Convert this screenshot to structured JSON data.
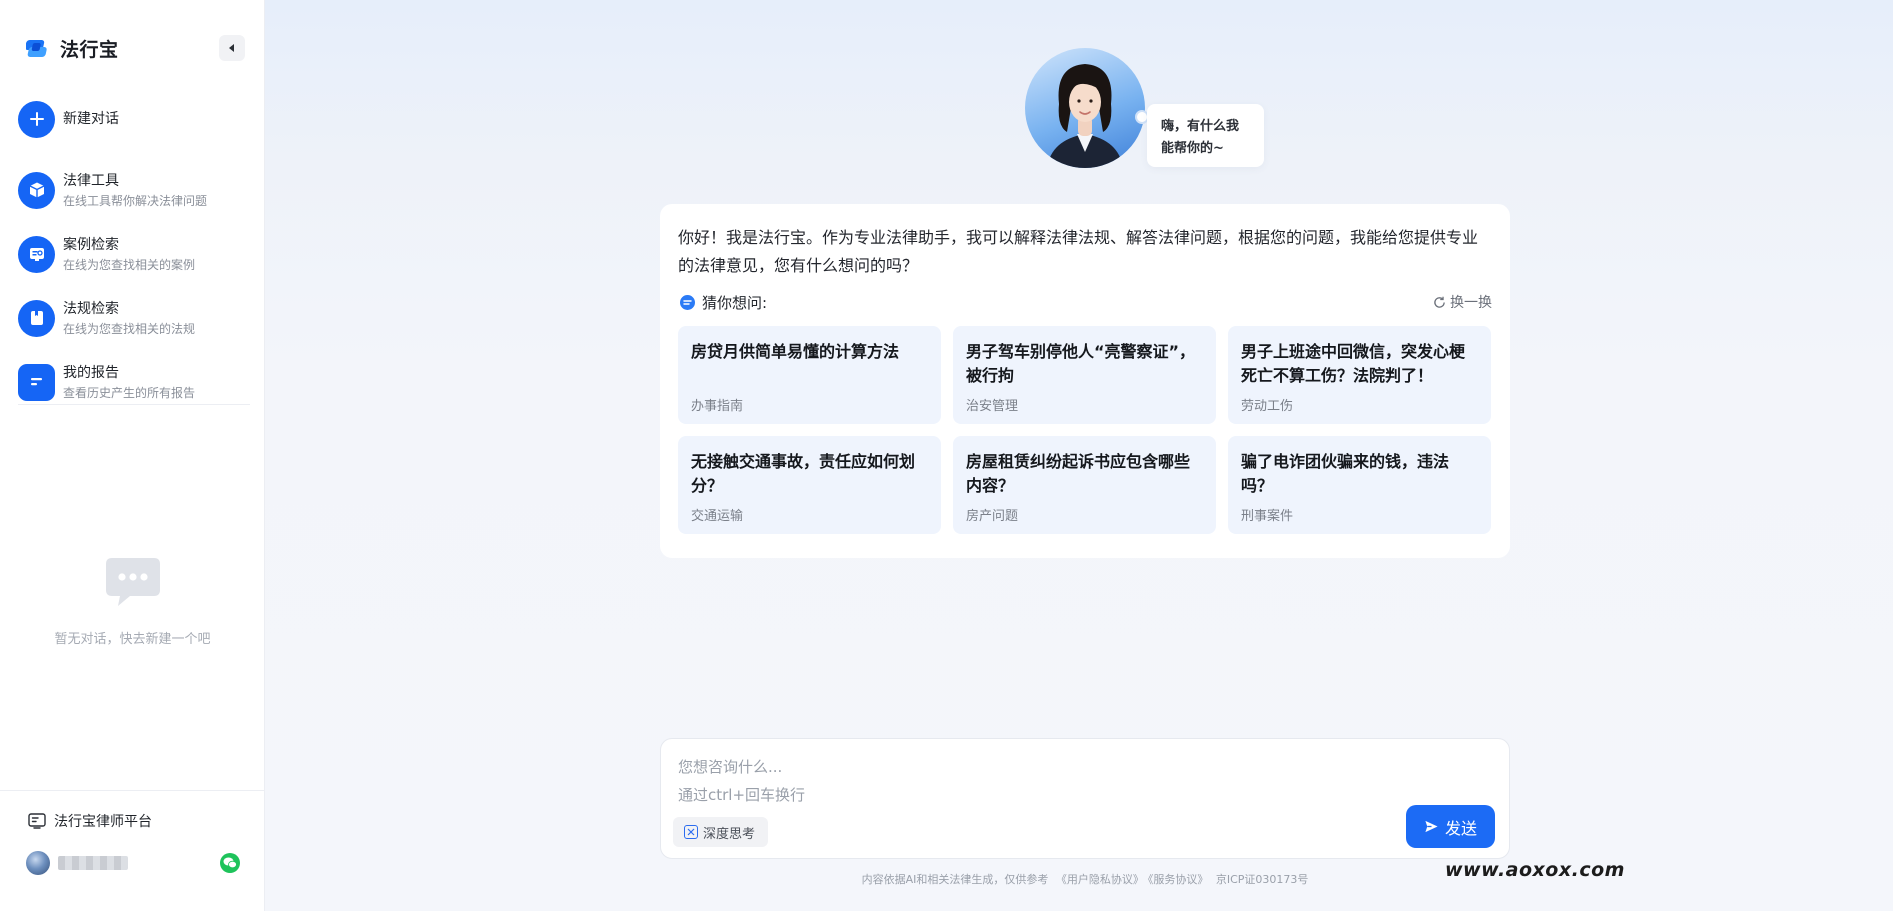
{
  "brand": {
    "name": "法行宝",
    "accent": "#1565f5"
  },
  "sidebar": {
    "items": [
      {
        "title": "新建对话",
        "subtitle": "",
        "icon": "plus-icon"
      },
      {
        "title": "法律工具",
        "subtitle": "在线工具帮你解决法律问题",
        "icon": "cube-icon"
      },
      {
        "title": "案例检索",
        "subtitle": "在线为您查找相关的案例",
        "icon": "case-search-icon"
      },
      {
        "title": "法规检索",
        "subtitle": "在线为您查找相关的法规",
        "icon": "book-icon"
      },
      {
        "title": "我的报告",
        "subtitle": "查看历史产生的所有报告",
        "icon": "report-icon"
      }
    ],
    "empty_text": "暂无对话，快去新建一个吧",
    "lawyer_platform": "法行宝律师平台",
    "user_name": "••••••"
  },
  "hero": {
    "greeting": "嗨，有什么我能帮你的~"
  },
  "welcome": {
    "intro": "你好！我是法行宝。作为专业法律助手，我可以解释法律法规、解答法律问题，根据您的问题，我能给您提供专业的法律意见，您有什么想问的吗？",
    "guess_title": "猜你想问:",
    "refresh_label": "换一换",
    "questions": [
      {
        "title": "房贷月供简单易懂的计算方法",
        "tag": "办事指南"
      },
      {
        "title": "男子驾车别停他人“亮警察证”，被行拘",
        "tag": "治安管理"
      },
      {
        "title": "男子上班途中回微信，突发心梗死亡不算工伤？法院判了！",
        "tag": "劳动工伤"
      },
      {
        "title": "无接触交通事故，责任应如何划分？",
        "tag": "交通运输"
      },
      {
        "title": "房屋租赁纠纷起诉书应包含哪些内容？",
        "tag": "房产问题"
      },
      {
        "title": "骗了电诈团伙骗来的钱，违法吗？",
        "tag": "刑事案件"
      }
    ]
  },
  "composer": {
    "placeholder": "您想咨询什么...\n通过ctrl+回车换行",
    "deep_think_label": "深度思考",
    "send_label": "发送"
  },
  "footer": {
    "disclaimer": "内容依据AI和相关法律生成，仅供参考",
    "privacy": "《用户隐私协议》",
    "service": "《服务协议》",
    "icp": "京ICP证030173号"
  },
  "watermark": "www.aoxox.com"
}
